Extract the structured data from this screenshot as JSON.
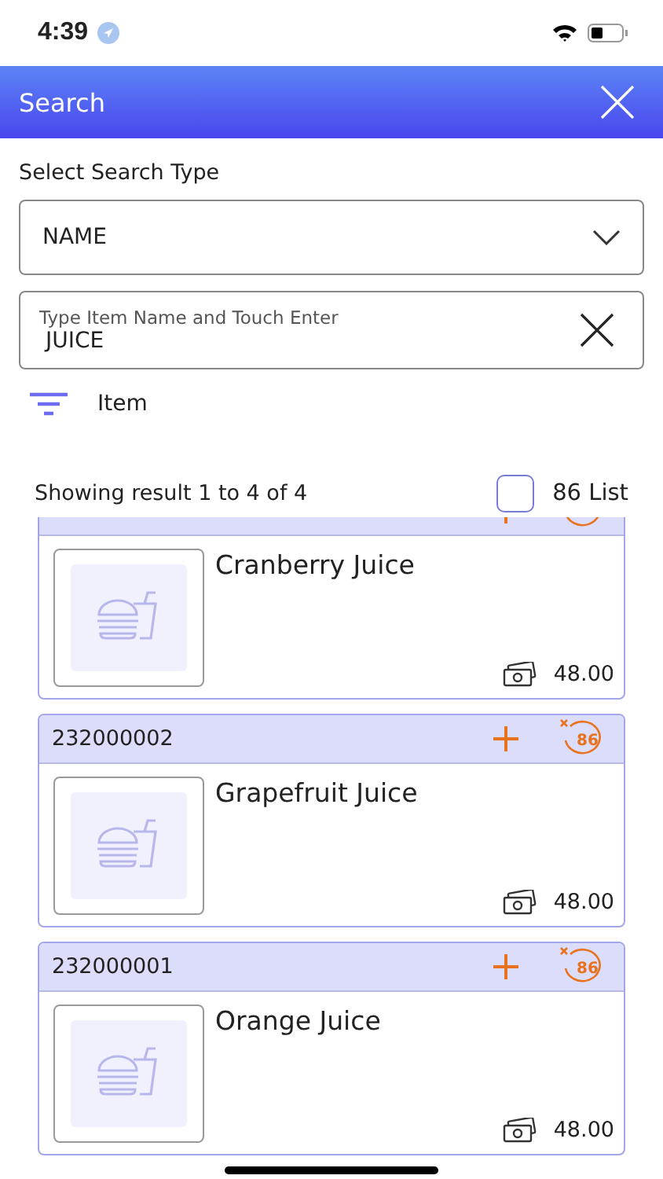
{
  "status_bar": {
    "time": "4:39"
  },
  "header": {
    "title": "Search"
  },
  "search_type": {
    "label": "Select Search Type",
    "value": "NAME"
  },
  "search_field": {
    "placeholder": "Type Item Name and Touch Enter",
    "value": "JUICE"
  },
  "filter": {
    "label": "Item"
  },
  "results": {
    "summary": "Showing result 1 to 4 of 4",
    "list_toggle": {
      "label": "86 List",
      "checked": false
    }
  },
  "items": [
    {
      "name": "Cranberry Juice",
      "price": "48.00"
    },
    {
      "code": "232000002",
      "badge": "86",
      "name": "Grapefruit Juice",
      "price": "48.00"
    },
    {
      "code": "232000001",
      "badge": "86",
      "name": "Orange Juice",
      "price": "48.00"
    }
  ]
}
